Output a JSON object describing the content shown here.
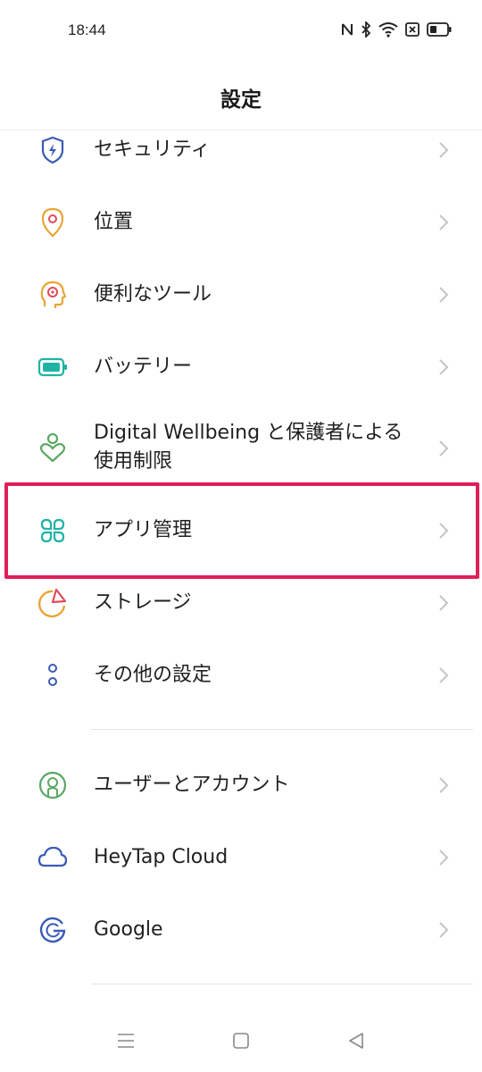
{
  "status_bar": {
    "time": "18:44",
    "icons": [
      "nfc-icon",
      "bluetooth-icon",
      "wifi-icon",
      "no-sim-icon",
      "battery-icon"
    ]
  },
  "header": {
    "title": "設定"
  },
  "settings": {
    "items": [
      {
        "label": "セキュリティ",
        "icon": "shield-icon",
        "color": "#3a5bb5"
      },
      {
        "label": "位置",
        "icon": "location-pin-icon",
        "color": "#e8a534"
      },
      {
        "label": "便利なツール",
        "icon": "smart-tools-icon",
        "color": "#e8a534"
      },
      {
        "label": "バッテリー",
        "icon": "battery-icon",
        "color": "#1fb3a5"
      },
      {
        "label": "Digital Wellbeing と保護者による",
        "label2": "使用制限",
        "icon": "wellbeing-icon",
        "color": "#5aa862"
      },
      {
        "label": "アプリ管理",
        "icon": "app-grid-icon",
        "color": "#1fb3a5"
      },
      {
        "label": "ストレージ",
        "icon": "storage-pie-icon",
        "color": "#e8a534"
      },
      {
        "label": "その他の設定",
        "icon": "more-settings-icon",
        "color": "#3a5bb5"
      },
      {
        "label": "ユーザーとアカウント",
        "icon": "user-account-icon",
        "color": "#5aa862"
      },
      {
        "label": "HeyTap Cloud",
        "icon": "cloud-icon",
        "color": "#3a5bb5"
      },
      {
        "label": "Google",
        "icon": "google-icon",
        "color": "#3a5bb5"
      }
    ]
  },
  "highlight_color": "#e01e5a"
}
